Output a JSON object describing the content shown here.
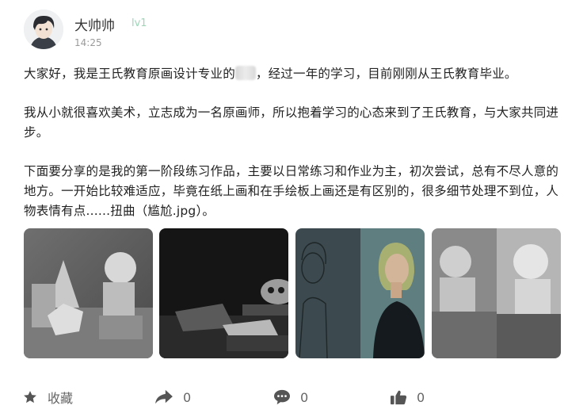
{
  "user": {
    "name": "大帅帅",
    "level": "lv1",
    "time": "14:25"
  },
  "post": {
    "p1_before": "大家好，我是王氏教育原画设计专业的",
    "p1_after": "，经过一年的学习，目前刚刚从王氏教育毕业。",
    "p2": "我从小就很喜欢美术，立志成为一名原画师，所以抱着学习的心态来到了王氏教育，与大家共同进步。",
    "p3": "下面要分享的是我的第一阶段练习作品，主要以日常练习和作业为主，初次尝试，总有不尽人意的地方。一开始比较难适应，毕竟在纸上画和在手绘板上画还是有区别的，很多细节处理不到位，人物表情有点......扭曲（尴尬.jpg）。"
  },
  "images": [
    {
      "icon": "geometric-still-life-sketch"
    },
    {
      "icon": "skull-still-life-painting"
    },
    {
      "icon": "woman-portrait-sketch-and-painting"
    },
    {
      "icon": "sphere-cube-sketch-and-render"
    }
  ],
  "actions": {
    "favorite_label": "收藏",
    "share_count": "0",
    "comment_count": "0",
    "like_count": "0"
  },
  "colors": {
    "level": "#9ed6b8",
    "text": "#222222",
    "muted": "#666666",
    "icon": "#555555"
  }
}
